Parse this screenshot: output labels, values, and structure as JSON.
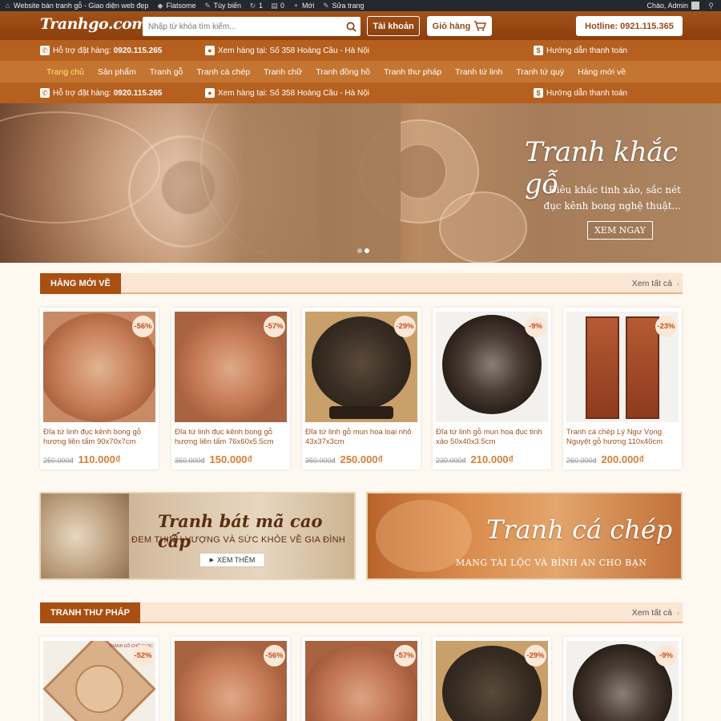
{
  "adminbar": {
    "site_name": "Website bán tranh gỗ - Giao diện web đẹp",
    "theme": "Flatsome",
    "customize": "Tùy biến",
    "updates": "1",
    "comments": "0",
    "new": "Mới",
    "edit": "Sửa trang",
    "greeting": "Chào, Admin"
  },
  "header": {
    "logo": "Tranhgo.com.vn",
    "search_placeholder": "Nhập từ khóa tìm kiếm...",
    "account_label": "Tài khoản",
    "cart_label": "Giỏ hàng",
    "hotline_label": "Hotline: 0921.115.365"
  },
  "infobar": {
    "support_label": "Hỗ trợ đặt hàng:",
    "support_phone": "0920.115.265",
    "address_label": "Xem hàng tại: Số 358 Hoàng Cầu - Hà Nội",
    "payment_label": "Hướng dẫn thanh toán"
  },
  "nav": {
    "items": [
      "Trang chủ",
      "Sản phẩm",
      "Tranh gỗ",
      "Tranh cá chép",
      "Tranh chữ",
      "Tranh đồng hồ",
      "Tranh thư pháp",
      "Tranh tứ linh",
      "Tranh tứ quý",
      "Hàng mới về"
    ]
  },
  "hero": {
    "title": "Tranh khắc gỗ",
    "subtitle_line1": "Điêu khắc tinh xảo, sắc nét",
    "subtitle_line2": "đục kênh bong nghệ thuật...",
    "button": "XEM NGAY"
  },
  "section_new": {
    "title": "HÀNG MỚI VỀ",
    "more": "Xem tất cả",
    "products": [
      {
        "name": "Đĩa tứ linh đục kênh bong gỗ hương liền tấm 90x70x7cm",
        "old": "250.000đ",
        "new": "110.000₫",
        "discount": "-56%"
      },
      {
        "name": "Đĩa tứ linh đục kênh bong gỗ hương liền tấm 76x60x5.5cm",
        "old": "350.000đ",
        "new": "150.000₫",
        "discount": "-57%"
      },
      {
        "name": "Đĩa tứ linh gỗ mun hoa loại nhỏ 43x37x3cm",
        "old": "350.000đ",
        "new": "250.000₫",
        "discount": "-29%"
      },
      {
        "name": "Đĩa tứ linh gỗ mun hoa đục tinh xảo 50x40x3.5cm",
        "old": "230.000đ",
        "new": "210.000₫",
        "discount": "-9%"
      },
      {
        "name": "Tranh cá chép Lý Ngư Vọng Nguyệt gỗ hương 110x40cm",
        "old": "260.000đ",
        "new": "200.000₫",
        "discount": "-23%"
      }
    ]
  },
  "promos": {
    "promo1_title": "Tranh bát mã cao cấp",
    "promo1_sub": "ĐEM THỊNH VƯỢNG VÀ SỨC KHỎE VỀ GIA ĐÌNH",
    "promo1_btn": "XEM THÊM",
    "promo2_title": "Tranh cá chép",
    "promo2_sub": "MANG TÀI LỘC VÀ BÌNH AN CHO BẠN"
  },
  "section_calligraphy": {
    "title": "TRANH THƯ PHÁP",
    "more": "Xem tất cả",
    "discounts": [
      "-52%",
      "-56%",
      "-57%",
      "-29%",
      "-9%"
    ],
    "frame_caption": "TRANH GỖ CHỮ PHÚC"
  },
  "colors": {
    "brand_brown": "#9a4a12",
    "info_bar": "#b5601e",
    "nav": "#c47531",
    "price": "#d47f3a",
    "nav_active": "#ffe37a"
  }
}
